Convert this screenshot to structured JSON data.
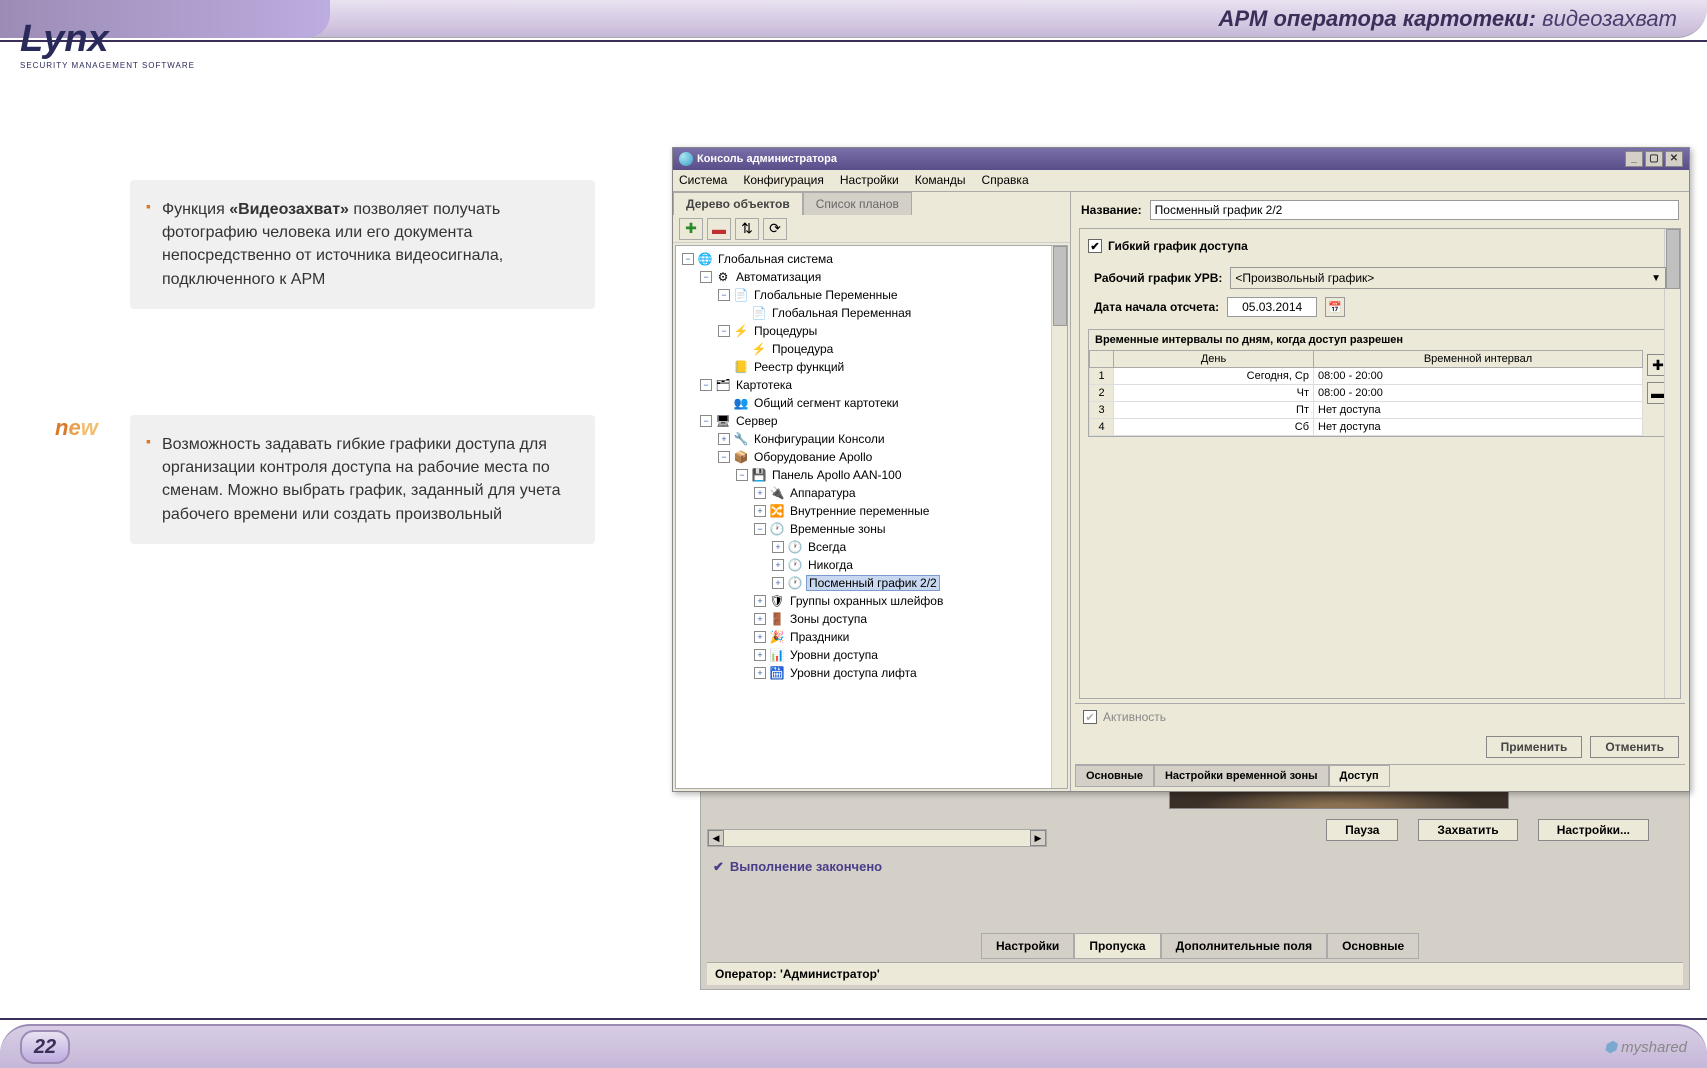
{
  "header": {
    "title_bold": "АРМ оператора картотеки:",
    "title_rest": " видеозахват",
    "logo_main": "Lynx",
    "logo_sub": "SECURITY MANAGEMENT SOFTWARE"
  },
  "bullets": {
    "b1_prefix": "Функция ",
    "b1_bold": "«Видеозахват»",
    "b1_rest": " позволяет получать фотографию человека или его документа непосредственно от источника видеосигнала, подключенного к АРМ",
    "b2": "Возможность задавать гибкие графики доступа для организации контроля доступа на рабочие места по сменам. Можно выбрать график, заданный для учета рабочего времени или создать произвольный",
    "new": "new"
  },
  "admin": {
    "title": "Консоль администратора",
    "menu": [
      "Система",
      "Конфигурация",
      "Настройки",
      "Команды",
      "Справка"
    ],
    "tabs": {
      "tree": "Дерево объектов",
      "plans": "Список планов"
    },
    "tree": [
      {
        "d": 0,
        "t": "-",
        "i": "🌐",
        "l": "Глобальная система"
      },
      {
        "d": 1,
        "t": "-",
        "i": "⚙",
        "l": "Автоматизация"
      },
      {
        "d": 2,
        "t": "-",
        "i": "📄",
        "l": "Глобальные Переменные"
      },
      {
        "d": 3,
        "t": "",
        "i": "📄",
        "l": "Глобальная Переменная"
      },
      {
        "d": 2,
        "t": "-",
        "i": "⚡",
        "l": "Процедуры"
      },
      {
        "d": 3,
        "t": "",
        "i": "⚡",
        "l": "Процедура"
      },
      {
        "d": 2,
        "t": "",
        "i": "📒",
        "l": "Реестр функций"
      },
      {
        "d": 1,
        "t": "-",
        "i": "🗂",
        "l": "Картотека"
      },
      {
        "d": 2,
        "t": "",
        "i": "👥",
        "l": "Общий сегмент картотеки"
      },
      {
        "d": 1,
        "t": "-",
        "i": "🖥",
        "l": "Сервер"
      },
      {
        "d": 2,
        "t": "+",
        "i": "🔧",
        "l": "Конфигурации Консоли"
      },
      {
        "d": 2,
        "t": "-",
        "i": "📦",
        "l": "Оборудование Apollo"
      },
      {
        "d": 3,
        "t": "-",
        "i": "💾",
        "l": "Панель Apollo AAN-100"
      },
      {
        "d": 4,
        "t": "+",
        "i": "🔌",
        "l": "Аппаратура"
      },
      {
        "d": 4,
        "t": "+",
        "i": "🔀",
        "l": "Внутренние переменные"
      },
      {
        "d": 4,
        "t": "-",
        "i": "🕐",
        "l": "Временные зоны"
      },
      {
        "d": 5,
        "t": "+",
        "i": "🕐",
        "l": "Всегда"
      },
      {
        "d": 5,
        "t": "+",
        "i": "🕐",
        "l": "Никогда"
      },
      {
        "d": 5,
        "t": "+",
        "i": "🕐",
        "l": "Посменный график 2/2",
        "sel": true
      },
      {
        "d": 4,
        "t": "+",
        "i": "🛡",
        "l": "Группы охранных шлейфов"
      },
      {
        "d": 4,
        "t": "+",
        "i": "🚪",
        "l": "Зоны доступа"
      },
      {
        "d": 4,
        "t": "+",
        "i": "🎉",
        "l": "Праздники"
      },
      {
        "d": 4,
        "t": "+",
        "i": "📊",
        "l": "Уровни доступа"
      },
      {
        "d": 4,
        "t": "+",
        "i": "🛗",
        "l": "Уровни доступа лифта"
      }
    ],
    "form": {
      "name_label": "Название:",
      "name_value": "Посменный график 2/2",
      "flex_checkbox": "Гибкий график доступа",
      "urv_label": "Рабочий график УРВ:",
      "urv_value": "<Произвольный график>",
      "date_label": "Дата начала отсчета:",
      "date_value": "05.03.2014",
      "interval_title": "Временные интервалы по дням, когда доступ разрешен",
      "col_day": "День",
      "col_interval": "Временной интервал",
      "rows": [
        {
          "n": "1",
          "d": "Сегодня, Ср",
          "v": "08:00 - 20:00"
        },
        {
          "n": "2",
          "d": "Чт",
          "v": "08:00 - 20:00"
        },
        {
          "n": "3",
          "d": "Пт",
          "v": "Нет доступа"
        },
        {
          "n": "4",
          "d": "Сб",
          "v": "Нет доступа"
        }
      ],
      "activity": "Активность",
      "apply": "Применить",
      "cancel": "Отменить",
      "bottom_tabs": [
        "Основные",
        "Настройки временной зоны",
        "Доступ"
      ]
    }
  },
  "bg": {
    "status": "Выполнение закончено",
    "operator": "Оператор: 'Администратор'",
    "pause": "Пауза",
    "capture": "Захватить",
    "settings": "Настройки...",
    "tabs": [
      "Настройки",
      "Пропуска",
      "Дополнительные поля",
      "Основные"
    ]
  },
  "footer": {
    "page": "22",
    "brand": "myshared"
  }
}
